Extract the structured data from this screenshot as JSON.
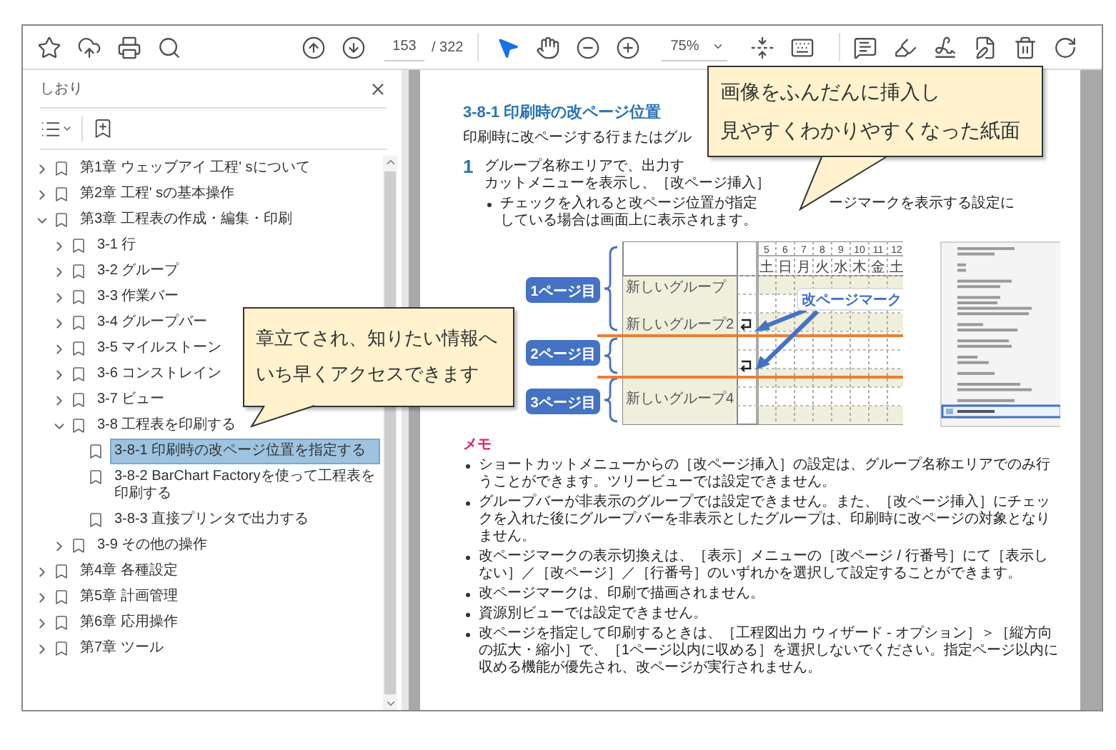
{
  "toolbar": {
    "quick_tools": [
      {
        "kind": "star"
      },
      {
        "kind": "upload"
      },
      {
        "kind": "print"
      },
      {
        "kind": "find"
      }
    ],
    "nav_tools": [
      {
        "kind": "prev"
      },
      {
        "kind": "next"
      }
    ],
    "page_number": "153",
    "page_count": "/ 322",
    "cursor_tools": [
      {
        "kind": "select",
        "selected": true
      },
      {
        "kind": "hand",
        "selected": false
      }
    ],
    "zoom_tools": [
      {
        "kind": "zoomout"
      },
      {
        "kind": "zoomin"
      }
    ],
    "zoom": "75%",
    "view_tools": [
      {
        "kind": "fit"
      },
      {
        "kind": "keyboard"
      }
    ],
    "edit_tools": [
      {
        "kind": "comment"
      },
      {
        "kind": "highlight"
      },
      {
        "kind": "sign"
      },
      {
        "kind": "edit"
      },
      {
        "kind": "trash"
      },
      {
        "kind": "rotate"
      }
    ]
  },
  "sidebar": {
    "title": "しおり",
    "bookmarks": [
      {
        "label": "第1章 ウェッブアイ 工程' sについて",
        "expanded": false,
        "selected": false
      },
      {
        "label": "第2章 工程' sの基本操作",
        "expanded": false,
        "selected": false
      },
      {
        "label": "第3章 工程表の作成・編集・印刷",
        "expanded": true,
        "selected": false,
        "children": [
          {
            "label": "3-1 行",
            "expanded": false,
            "selected": false
          },
          {
            "label": "3-2 グループ",
            "expanded": false,
            "selected": false
          },
          {
            "label": "3-3 作業バー",
            "expanded": false,
            "selected": false
          },
          {
            "label": "3-4 グループバー",
            "expanded": false,
            "selected": false
          },
          {
            "label": "3-5 マイルストーン",
            "expanded": false,
            "selected": false
          },
          {
            "label": "3-6 コンストレイン",
            "expanded": false,
            "selected": false
          },
          {
            "label": "3-7 ビュー",
            "expanded": false,
            "selected": false
          },
          {
            "label": "3-8 工程表を印刷する",
            "expanded": true,
            "selected": false,
            "children": [
              {
                "label": "3-8-1 印刷時の改ページ位置を指定する",
                "selected": true
              },
              {
                "label": "3-8-2 BarChart Factoryを使って工程表を印刷する",
                "selected": false
              },
              {
                "label": "3-8-3 直接プリンタで出力する",
                "selected": false
              }
            ]
          },
          {
            "label": "3-9 その他の操作",
            "expanded": false,
            "selected": false
          }
        ]
      },
      {
        "label": "第4章 各種設定",
        "expanded": false,
        "selected": false
      },
      {
        "label": "第5章 計画管理",
        "expanded": false,
        "selected": false
      },
      {
        "label": "第6章 応用操作",
        "expanded": false,
        "selected": false
      },
      {
        "label": "第7章 ツール",
        "expanded": false,
        "selected": false
      }
    ]
  },
  "document": {
    "heading": "3-8-1 印刷時の改ページ位置",
    "intro": "印刷時に改ページする行またはグル",
    "step": {
      "number": "1",
      "lines": [
        "グループ名称エリアで、出力す",
        "カットメニューを表示し、［改ページ挿入］"
      ]
    },
    "bullet": [
      "チェックを入れると改ページ位置が指定",
      "ージマークを表示する設定に",
      "している場合は画面上に表示されます。"
    ],
    "figure": {
      "page_labels": [
        "1ページ目",
        "2ページ目",
        "3ページ目"
      ],
      "groups": [
        "新しいグループ",
        "新しいグループ2",
        "新しいグループ4"
      ],
      "days": [
        {
          "date": "5",
          "weekday": "土"
        },
        {
          "date": "6",
          "weekday": "日"
        },
        {
          "date": "7",
          "weekday": "月"
        },
        {
          "date": "8",
          "weekday": "火"
        },
        {
          "date": "9",
          "weekday": "水"
        },
        {
          "date": "10",
          "weekday": "木"
        },
        {
          "date": "11",
          "weekday": "金"
        },
        {
          "date": "12",
          "weekday": "土"
        }
      ],
      "mark_label": "改ページマーク"
    },
    "memo": {
      "title": "メモ",
      "items": [
        "ショートカットメニューからの［改ページ挿入］の設定は、グループ名称エリアでのみ行うことができます。ツリービューでは設定できません。",
        "グループバーが非表示のグループでは設定できません。また、［改ページ挿入］にチェックを入れた後にグループバーを非表示としたグループは、印刷時に改ページの対象となりません。",
        "改ページマークの表示切換えは、［表示］メニューの［改ページ / 行番号］にて［表示しない］／［改ページ］／［行番号］のいずれかを選択して設定することができます。",
        "改ページマークは、印刷で描画されません。",
        "資源別ビューでは設定できません。",
        "改ページを指定して印刷するときは、［工程図出力 ウィザード - オプション］＞［縦方向の拡大・縮小］で、［1ページ以内に収める］を選択しないでください。指定ページ以内に収める機能が優先され、改ページが実行されません。"
      ]
    }
  },
  "callouts": [
    {
      "lines": [
        "章立てされ、知りたい情報へ",
        "いち早くアクセスできます"
      ]
    },
    {
      "lines": [
        "画像をふんだんに挿入し",
        "見やすくわかりやすくなった紙面"
      ]
    }
  ]
}
